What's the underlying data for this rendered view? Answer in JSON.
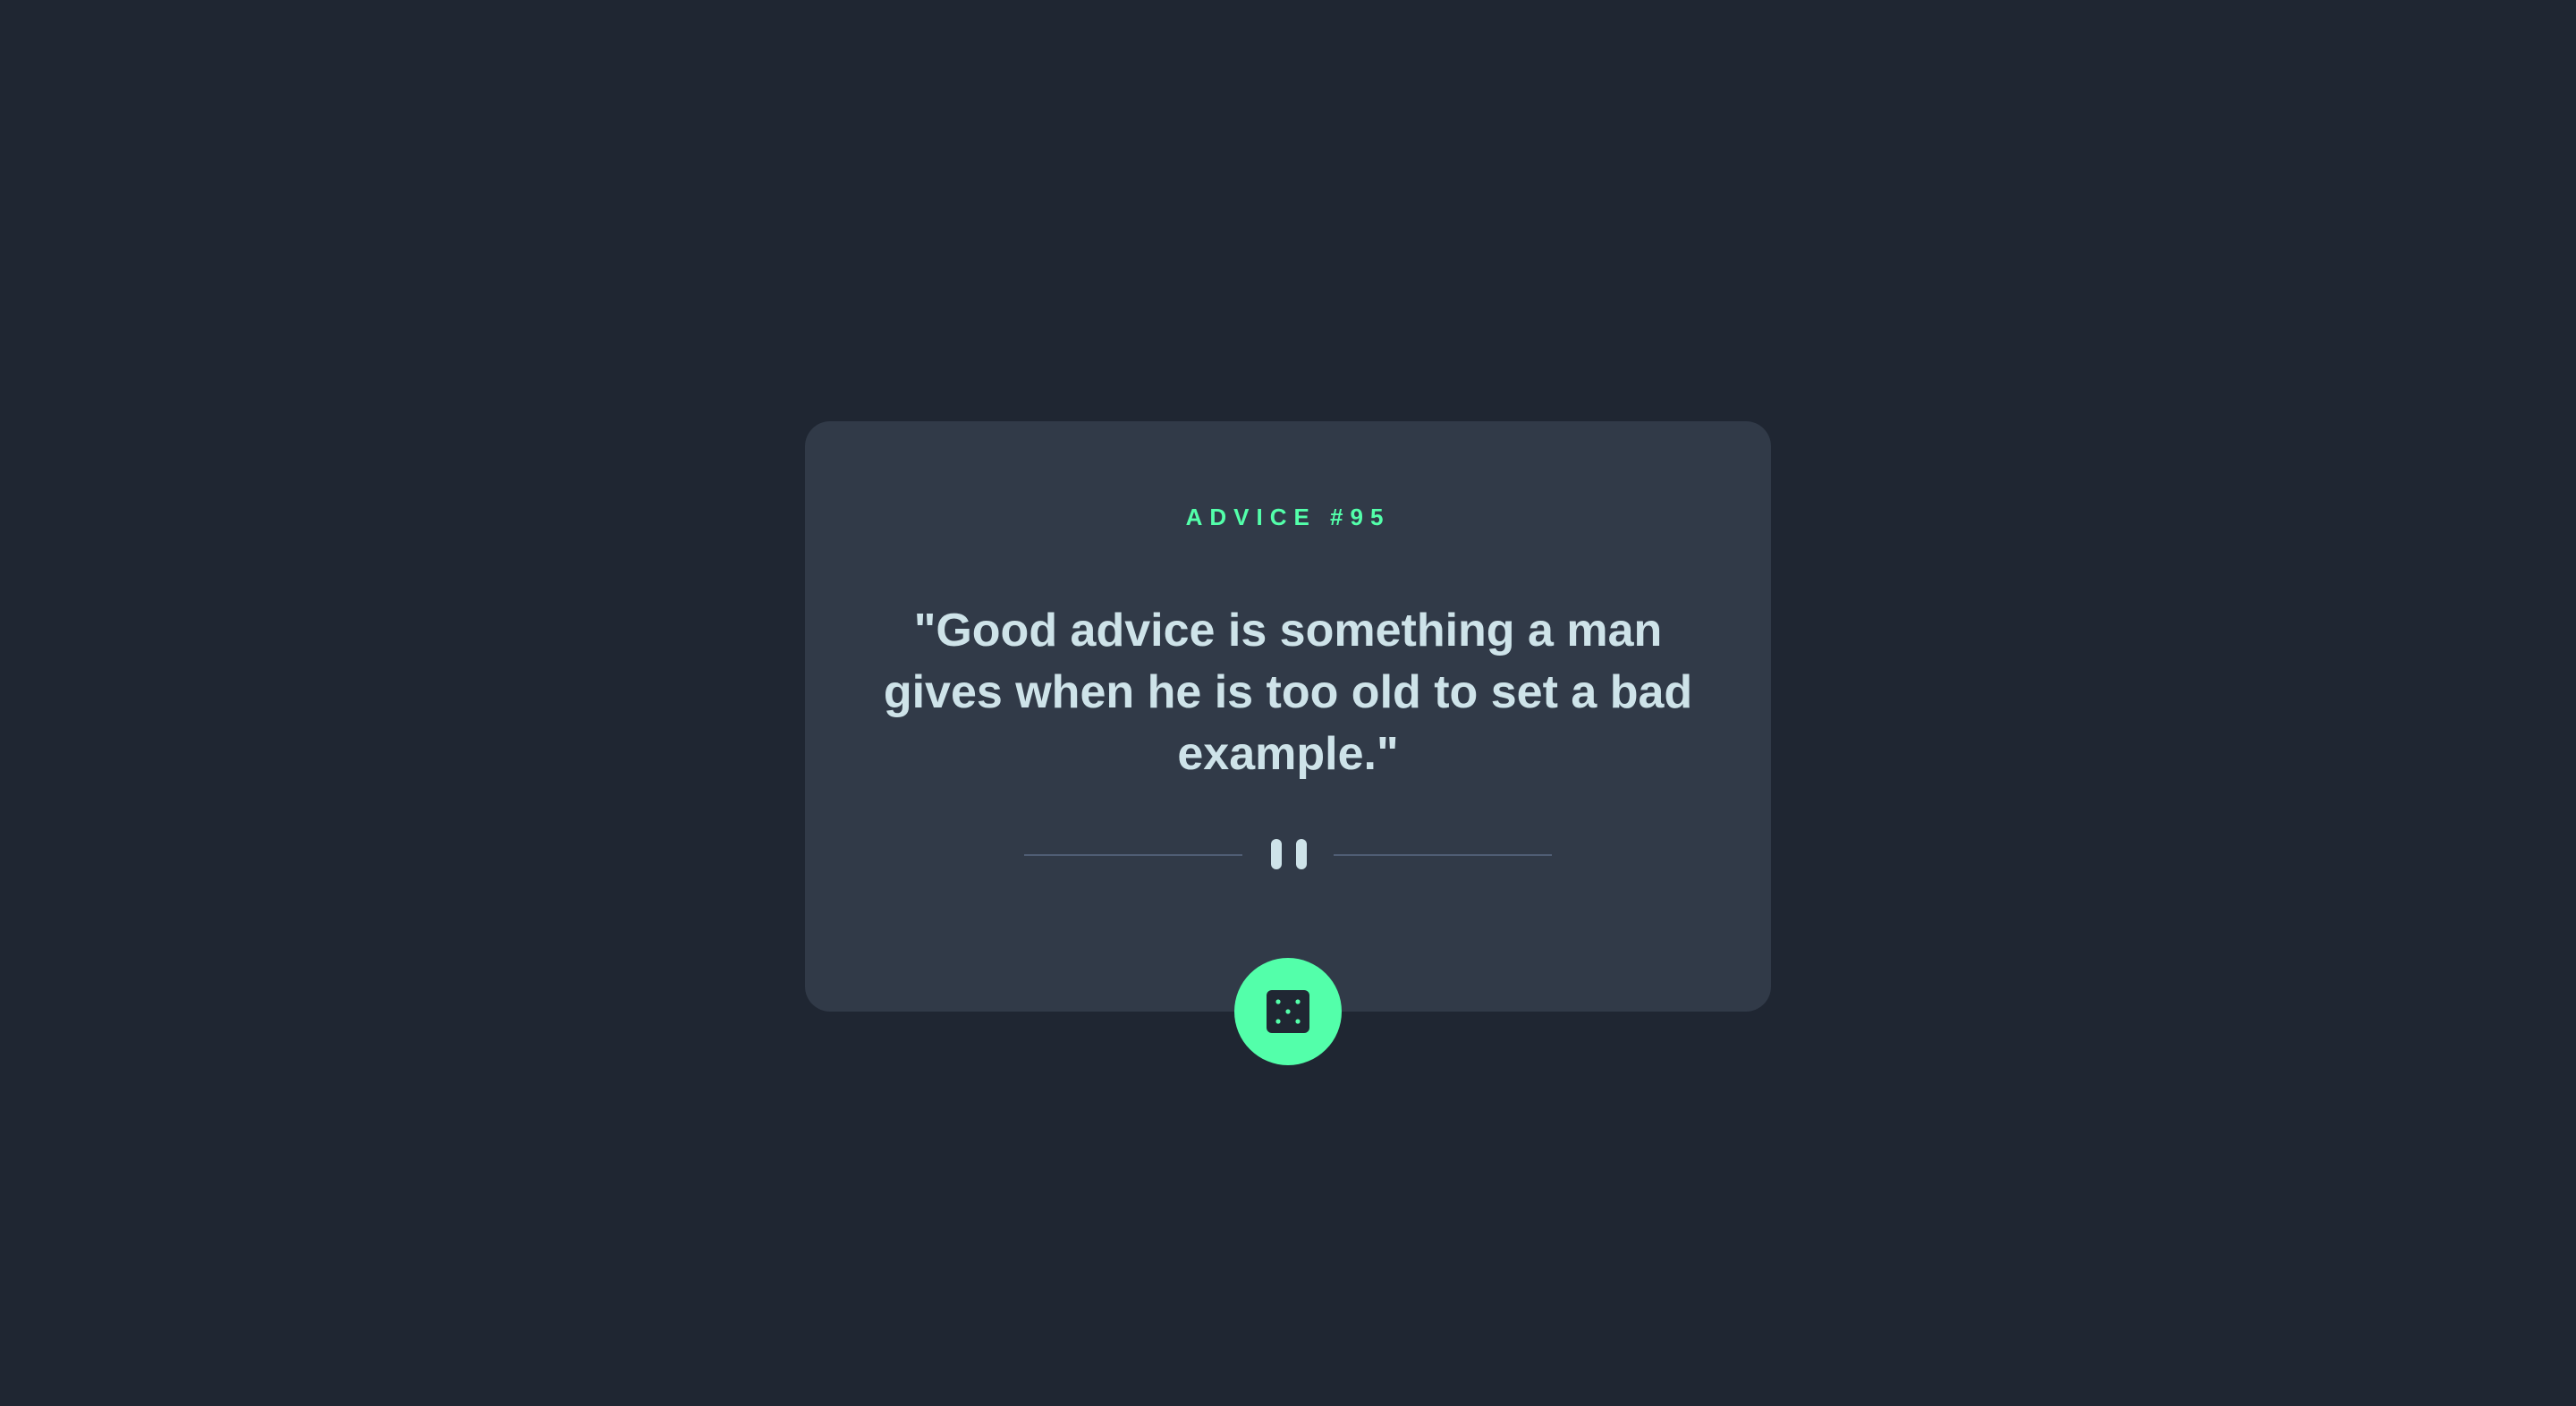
{
  "advice": {
    "heading": "ADVICE #95",
    "quote": "\"Good advice is something a man gives when he is too old to set a bad example.\""
  },
  "icons": {
    "divider": "pause-icon",
    "button": "dice-icon"
  },
  "colors": {
    "background": "#1F2632",
    "card": "#313A48",
    "accent": "#53FFAA",
    "text": "#CEE3E9",
    "divider": "#4F5D74"
  }
}
